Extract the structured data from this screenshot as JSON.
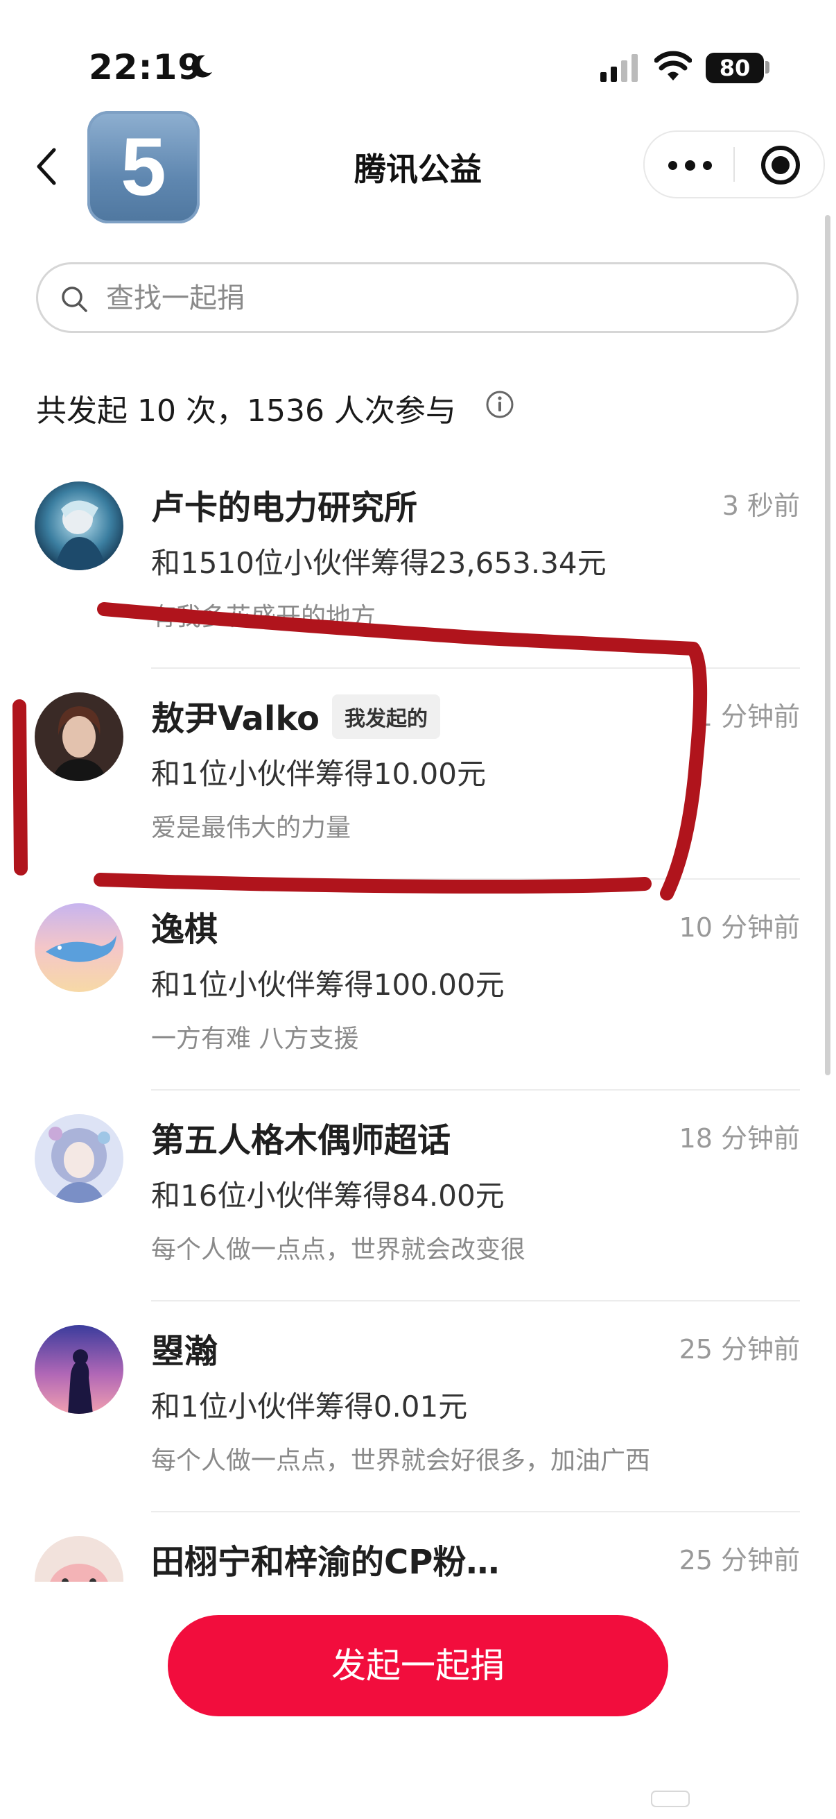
{
  "status_bar": {
    "time": "22:19",
    "battery": "80"
  },
  "nav": {
    "app_badge": "5",
    "title": "腾讯公益"
  },
  "search": {
    "placeholder": "查找一起捐"
  },
  "summary": {
    "text": "共发起 10 次，1536 人次参与"
  },
  "items": [
    {
      "name": "卢卡的电力研究所",
      "tag": "",
      "time": "3 秒前",
      "amount": "和1510位小伙伴筹得23,653.34元",
      "message": "有我多花盛开的地方"
    },
    {
      "name": "敖尹Valko",
      "tag": "我发起的",
      "time": "1 分钟前",
      "amount": "和1位小伙伴筹得10.00元",
      "message": "爱是最伟大的力量"
    },
    {
      "name": "逸棋",
      "tag": "",
      "time": "10 分钟前",
      "amount": "和1位小伙伴筹得100.00元",
      "message": "一方有难 八方支援"
    },
    {
      "name": "第五人格木偶师超话",
      "tag": "",
      "time": "18 分钟前",
      "amount": "和16位小伙伴筹得84.00元",
      "message": "每个人做一点点，世界就会改变很"
    },
    {
      "name": "曌瀚",
      "tag": "",
      "time": "25 分钟前",
      "amount": "和1位小伙伴筹得0.01元",
      "message": "每个人做一点点，世界就会好很多，加油广西"
    },
    {
      "name": "田栩宁和梓渝的CP粉…",
      "tag": "",
      "time": "25 分钟前",
      "amount": "",
      "message": ""
    }
  ],
  "cta": {
    "label": "发起一起捐"
  },
  "colors": {
    "primary": "#f20d3d",
    "annotation": "#b0141c"
  }
}
